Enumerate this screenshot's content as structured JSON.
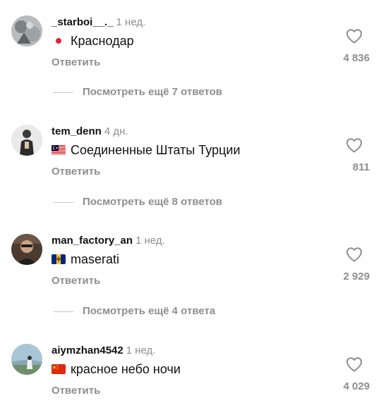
{
  "reply_label": "Ответить",
  "comments": [
    {
      "username": "_starboi__._",
      "time": "1 нед.",
      "flag": "japan-flag",
      "text": "Краснодар",
      "likes": "4 836",
      "view_replies": "Посмотреть ещё 7 ответов"
    },
    {
      "username": "tem_denn",
      "time": "4 дн.",
      "flag": "malaysia-flag",
      "text": "Соединенные Штаты Турции",
      "likes": "811",
      "view_replies": "Посмотреть ещё 8 ответов"
    },
    {
      "username": "man_factory_an",
      "time": "1 нед.",
      "flag": "barbados-flag",
      "text": "maserati",
      "likes": "2 929",
      "view_replies": "Посмотреть ещё 4 ответа"
    },
    {
      "username": "aiymzhan4542",
      "time": "1 нед.",
      "flag": "china-flag",
      "text": "красное небо ночи",
      "likes": "4 029"
    }
  ],
  "colors": {
    "text": "#111111",
    "secondary": "#8e8e8e",
    "divider": "#c7c7c7"
  }
}
